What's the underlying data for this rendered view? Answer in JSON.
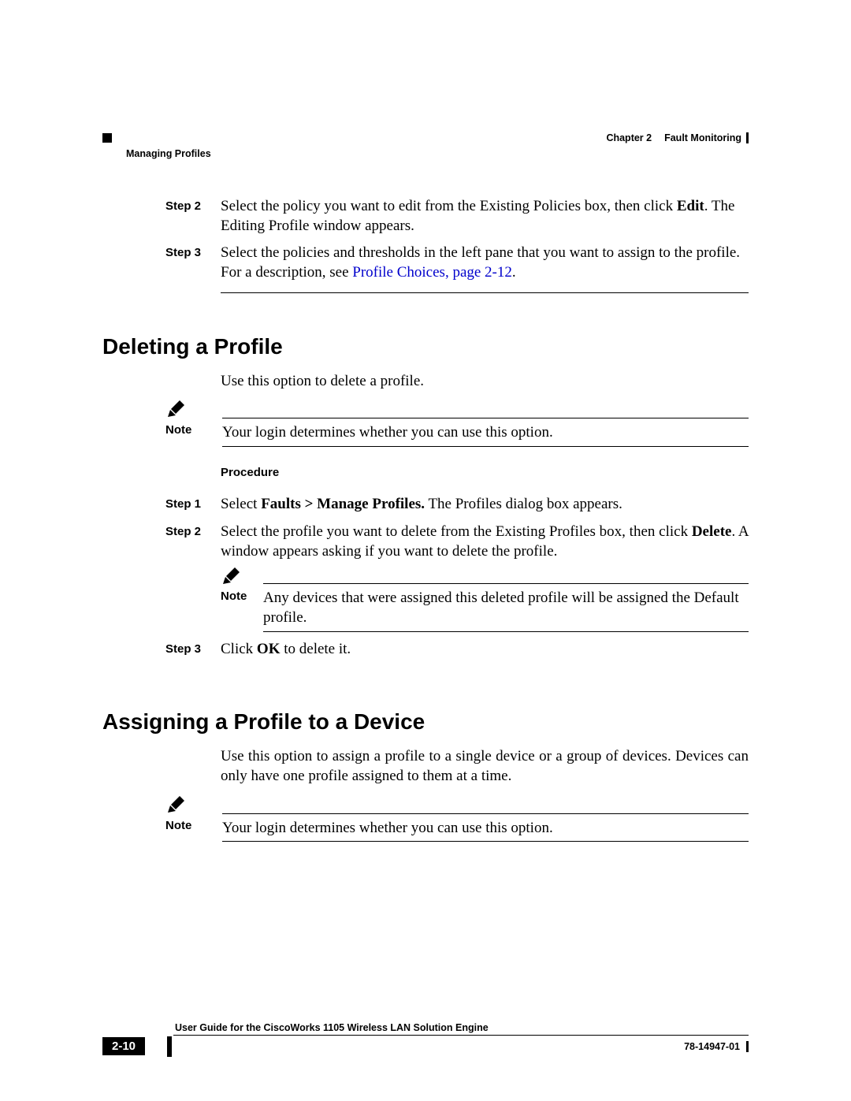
{
  "header": {
    "chapter": "Chapter 2",
    "chapter_title": "Fault Monitoring",
    "section": "Managing Profiles"
  },
  "top_steps": [
    {
      "label": "Step 2",
      "prefix": "Select the policy you want to edit from the Existing Policies box, then click ",
      "bold1": "Edit",
      "suffix": ". The Editing Profile window appears."
    },
    {
      "label": "Step 3",
      "prefix": "Select the policies and thresholds in the left pane that you want to assign to the profile. For a description, see ",
      "link": "Profile Choices, page 2-12",
      "suffix2": "."
    }
  ],
  "section1": {
    "title": "Deleting a Profile",
    "intro": "Use this option to delete a profile.",
    "note_label": "Note",
    "note_text": "Your login determines whether you can use this option.",
    "procedure_label": "Procedure",
    "steps": [
      {
        "label": "Step 1",
        "prefix": "Select ",
        "bold": "Faults > Manage Profiles.",
        "suffix": " The Profiles dialog box appears."
      },
      {
        "label": "Step 2",
        "prefix": "Select the profile you want to delete from the Existing Profiles box, then click ",
        "bold": "Delete",
        "suffix": ". A window appears asking if you want to delete the profile.",
        "inner_note_label": "Note",
        "inner_note_text": "Any devices that were assigned this deleted profile will be assigned the Default profile."
      },
      {
        "label": "Step 3",
        "prefix": "Click ",
        "bold": "OK",
        "suffix": " to delete it."
      }
    ]
  },
  "section2": {
    "title": "Assigning a Profile to a Device",
    "intro": "Use this option to assign a profile to a single device or a group of devices. Devices can only have one profile assigned to them at a time.",
    "note_label": "Note",
    "note_text": "Your login determines whether you can use this option."
  },
  "footer": {
    "page_number": "2-10",
    "doc_title": "User Guide for the CiscoWorks 1105 Wireless LAN Solution Engine",
    "doc_id": "78-14947-01"
  }
}
